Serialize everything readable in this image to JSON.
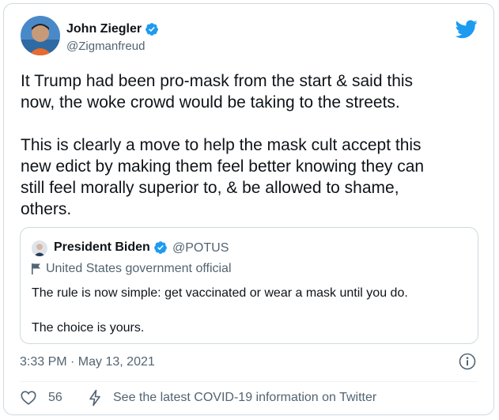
{
  "author": {
    "name": "John Ziegler",
    "handle": "@Zigmanfreud",
    "verified": true
  },
  "tweet": {
    "paragraphs": [
      "It Trump had been pro-mask from the start & said this\nnow, the woke crowd would be taking to the streets.",
      "This is clearly a move to help the mask cult accept this\nnew edict by making them feel better knowing they can\nstill feel morally superior to, & be allowed to shame,\nothers."
    ]
  },
  "quoted": {
    "name": "President Biden",
    "handle": "@POTUS",
    "label": "United States government official",
    "paragraphs": [
      "The rule is now simple: get vaccinated or wear a mask until you do.",
      "The choice is yours."
    ]
  },
  "meta": {
    "timestamp": "3:33 PM · May 13, 2021",
    "likes": "56",
    "covid_link": "See the latest COVID-19 information on Twitter"
  },
  "colors": {
    "accent": "#1d9bf0",
    "text_primary": "#0f1419",
    "text_secondary": "#536471",
    "border": "#cfd9de"
  },
  "icons": [
    "verified-badge-icon",
    "twitter-bird-icon",
    "flag-icon",
    "info-icon",
    "heart-icon",
    "lightning-icon"
  ]
}
